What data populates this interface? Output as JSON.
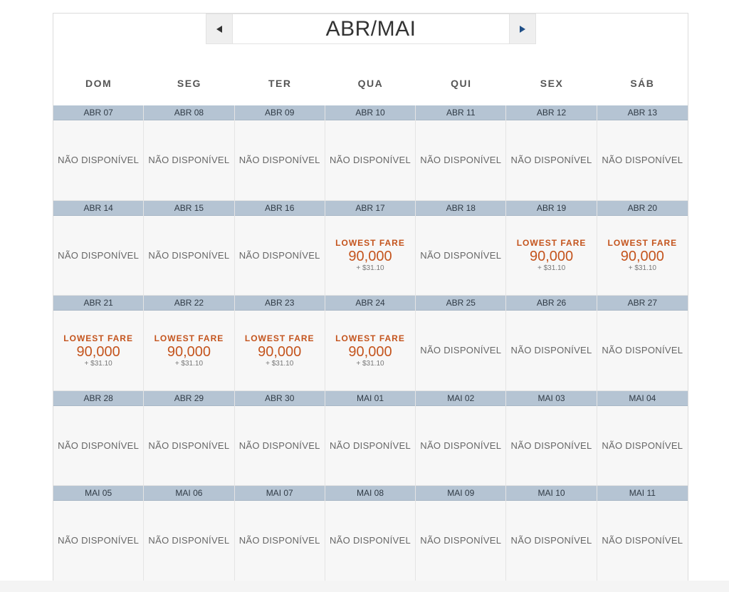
{
  "calendar": {
    "title": "ABR/MAI",
    "prev_icon": "triangle-left",
    "next_icon": "triangle-right",
    "weekdays": [
      "DOM",
      "SEG",
      "TER",
      "QUA",
      "QUI",
      "SEX",
      "SÁB"
    ],
    "colors": {
      "header_band": "#b5c4d3",
      "fare": "#c4541d"
    },
    "days": [
      {
        "date": "ABR 07",
        "status": "NÃO DISPONÍVEL"
      },
      {
        "date": "ABR 08",
        "status": "NÃO DISPONÍVEL"
      },
      {
        "date": "ABR 09",
        "status": "NÃO DISPONÍVEL"
      },
      {
        "date": "ABR 10",
        "status": "NÃO DISPONÍVEL"
      },
      {
        "date": "ABR 11",
        "status": "NÃO DISPONÍVEL"
      },
      {
        "date": "ABR 12",
        "status": "NÃO DISPONÍVEL"
      },
      {
        "date": "ABR 13",
        "status": "NÃO DISPONÍVEL"
      },
      {
        "date": "ABR 14",
        "status": "NÃO DISPONÍVEL"
      },
      {
        "date": "ABR 15",
        "status": "NÃO DISPONÍVEL"
      },
      {
        "date": "ABR 16",
        "status": "NÃO DISPONÍVEL"
      },
      {
        "date": "ABR 17",
        "fare_label": "LOWEST FARE",
        "miles": "90,000",
        "tax": "+ $31.10"
      },
      {
        "date": "ABR 18",
        "status": "NÃO DISPONÍVEL"
      },
      {
        "date": "ABR 19",
        "fare_label": "LOWEST FARE",
        "miles": "90,000",
        "tax": "+ $31.10"
      },
      {
        "date": "ABR 20",
        "fare_label": "LOWEST FARE",
        "miles": "90,000",
        "tax": "+ $31.10"
      },
      {
        "date": "ABR 21",
        "fare_label": "LOWEST FARE",
        "miles": "90,000",
        "tax": "+ $31.10"
      },
      {
        "date": "ABR 22",
        "fare_label": "LOWEST FARE",
        "miles": "90,000",
        "tax": "+ $31.10"
      },
      {
        "date": "ABR 23",
        "fare_label": "LOWEST FARE",
        "miles": "90,000",
        "tax": "+ $31.10"
      },
      {
        "date": "ABR 24",
        "fare_label": "LOWEST FARE",
        "miles": "90,000",
        "tax": "+ $31.10"
      },
      {
        "date": "ABR 25",
        "status": "NÃO DISPONÍVEL"
      },
      {
        "date": "ABR 26",
        "status": "NÃO DISPONÍVEL"
      },
      {
        "date": "ABR 27",
        "status": "NÃO DISPONÍVEL"
      },
      {
        "date": "ABR 28",
        "status": "NÃO DISPONÍVEL"
      },
      {
        "date": "ABR 29",
        "status": "NÃO DISPONÍVEL"
      },
      {
        "date": "ABR 30",
        "status": "NÃO DISPONÍVEL"
      },
      {
        "date": "MAI 01",
        "status": "NÃO DISPONÍVEL"
      },
      {
        "date": "MAI 02",
        "status": "NÃO DISPONÍVEL"
      },
      {
        "date": "MAI 03",
        "status": "NÃO DISPONÍVEL"
      },
      {
        "date": "MAI 04",
        "status": "NÃO DISPONÍVEL"
      },
      {
        "date": "MAI 05",
        "status": "NÃO DISPONÍVEL"
      },
      {
        "date": "MAI 06",
        "status": "NÃO DISPONÍVEL"
      },
      {
        "date": "MAI 07",
        "status": "NÃO DISPONÍVEL"
      },
      {
        "date": "MAI 08",
        "status": "NÃO DISPONÍVEL"
      },
      {
        "date": "MAI 09",
        "status": "NÃO DISPONÍVEL"
      },
      {
        "date": "MAI 10",
        "status": "NÃO DISPONÍVEL"
      },
      {
        "date": "MAI 11",
        "status": "NÃO DISPONÍVEL"
      }
    ]
  }
}
